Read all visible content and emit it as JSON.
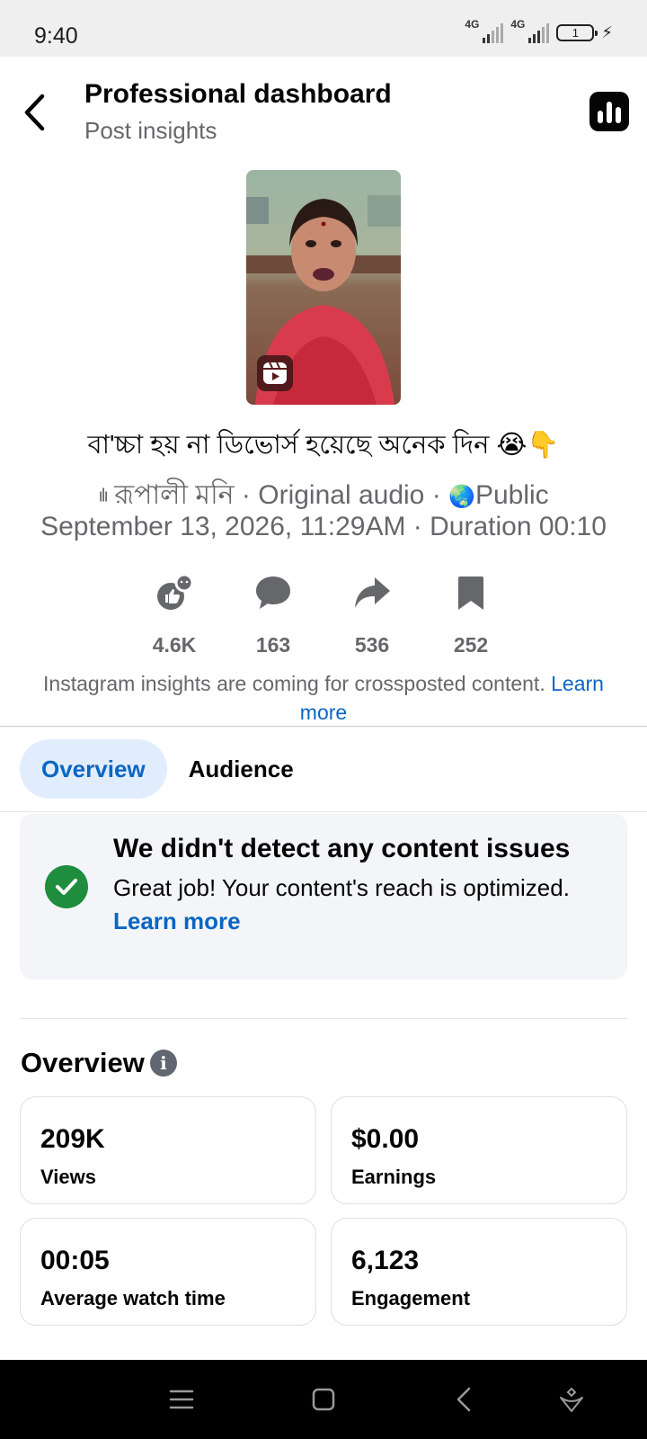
{
  "status_bar": {
    "time": "9:40",
    "network1": "4G",
    "network2": "4G",
    "battery": "1"
  },
  "header": {
    "title": "Professional dashboard",
    "subtitle": "Post insights"
  },
  "post": {
    "caption": "বা'চ্চা হয় না ডিভোর্স হয়েছে অনেক দিন 😭👇",
    "author": "রূপালী মনি",
    "audio": "Original audio",
    "privacy": "Public",
    "date": "September 13, 2026, 11:29AM",
    "duration": "Duration 00:10"
  },
  "metrics": {
    "reactions": "4.6K",
    "comments": "163",
    "shares": "536",
    "saves": "252"
  },
  "insights_note": {
    "text": "Instagram insights are coming for crossposted content.",
    "link": "Learn more"
  },
  "tabs": [
    {
      "label": "Overview",
      "active": true
    },
    {
      "label": "Audience",
      "active": false
    }
  ],
  "issues": {
    "title": "We didn't detect any content issues",
    "body": "Great job! Your content's reach is optimized.",
    "link": "Learn more"
  },
  "overview": {
    "title": "Overview",
    "cards": [
      {
        "value": "209K",
        "label": "Views"
      },
      {
        "value": "$0.00",
        "label": "Earnings"
      },
      {
        "value": "00:05",
        "label": "Average watch time"
      },
      {
        "value": "6,123",
        "label": "Engagement"
      }
    ]
  },
  "colors": {
    "accent": "#0a66c2",
    "tab_active_bg": "#e1edfd",
    "success": "#1e8e3e",
    "secondary_text": "#65676b"
  }
}
